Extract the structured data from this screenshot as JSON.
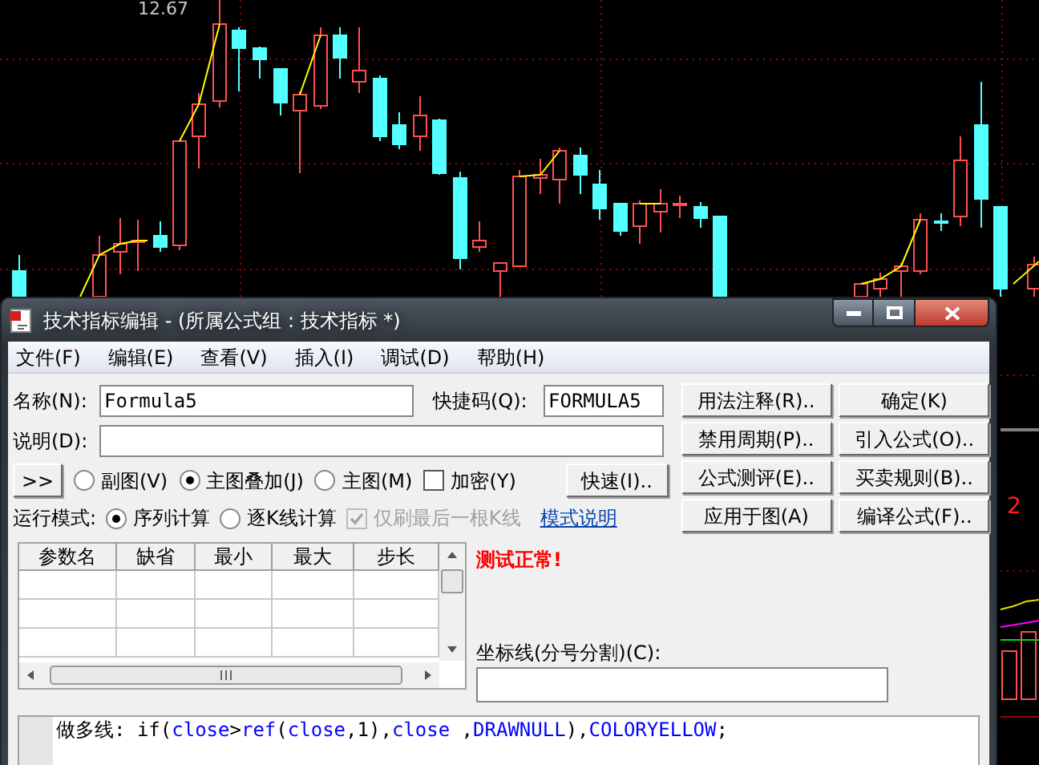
{
  "chart": {
    "price_label": "12.67",
    "edge_label": "2"
  },
  "window": {
    "title": "技术指标编辑 - (所属公式组 : 技术指标 *)"
  },
  "menu": [
    "文件(F)",
    "编辑(E)",
    "查看(V)",
    "插入(I)",
    "调试(D)",
    "帮助(H)"
  ],
  "fields": {
    "name": {
      "label": "名称(N):",
      "value": "Formula5"
    },
    "shortcut": {
      "label": "快捷码(Q):",
      "value": "FORMULA5"
    },
    "description": {
      "label": "说明(D):"
    }
  },
  "expand_button": ">>",
  "chart_type": [
    {
      "label": "副图(V)",
      "selected": false
    },
    {
      "label": "主图叠加(J)",
      "selected": true
    },
    {
      "label": "主图(M)",
      "selected": false
    }
  ],
  "encrypt": {
    "label": "加密(Y)",
    "checked": false
  },
  "quick_button": "快速(I)..",
  "run_mode": {
    "label": "运行模式:",
    "options": [
      {
        "label": "序列计算",
        "selected": true
      },
      {
        "label": "逐K线计算",
        "selected": false
      }
    ],
    "refresh_last": {
      "label": "仅刷最后一根K线",
      "checked": true,
      "disabled": true
    },
    "help_link": "模式说明"
  },
  "buttons": [
    "用法注释(R)..",
    "确定(K)",
    "禁用周期(P)..",
    "引入公式(O)..",
    "公式测评(E)..",
    "买卖规则(B)..",
    "应用于图(A)",
    "编译公式(F).."
  ],
  "params_table": {
    "columns": [
      "参数名",
      "缺省",
      "最小",
      "最大",
      "步长"
    ]
  },
  "status": "测试正常!",
  "axis_lines": {
    "label": "坐标线(分号分割)(C):"
  },
  "code": [
    {
      "kind": "plain",
      "text": "做多线: if("
    },
    {
      "kind": "keyword",
      "text": "close"
    },
    {
      "kind": "plain",
      "text": ">"
    },
    {
      "kind": "keyword",
      "text": "ref"
    },
    {
      "kind": "plain",
      "text": "("
    },
    {
      "kind": "keyword",
      "text": "close"
    },
    {
      "kind": "plain",
      "text": ",1),"
    },
    {
      "kind": "keyword",
      "text": "close"
    },
    {
      "kind": "plain",
      "text": " ,"
    },
    {
      "kind": "keyword",
      "text": "DRAWNULL"
    },
    {
      "kind": "plain",
      "text": "),"
    },
    {
      "kind": "keyword",
      "text": "COLORYELLOW"
    },
    {
      "kind": "plain",
      "text": ";"
    }
  ]
}
